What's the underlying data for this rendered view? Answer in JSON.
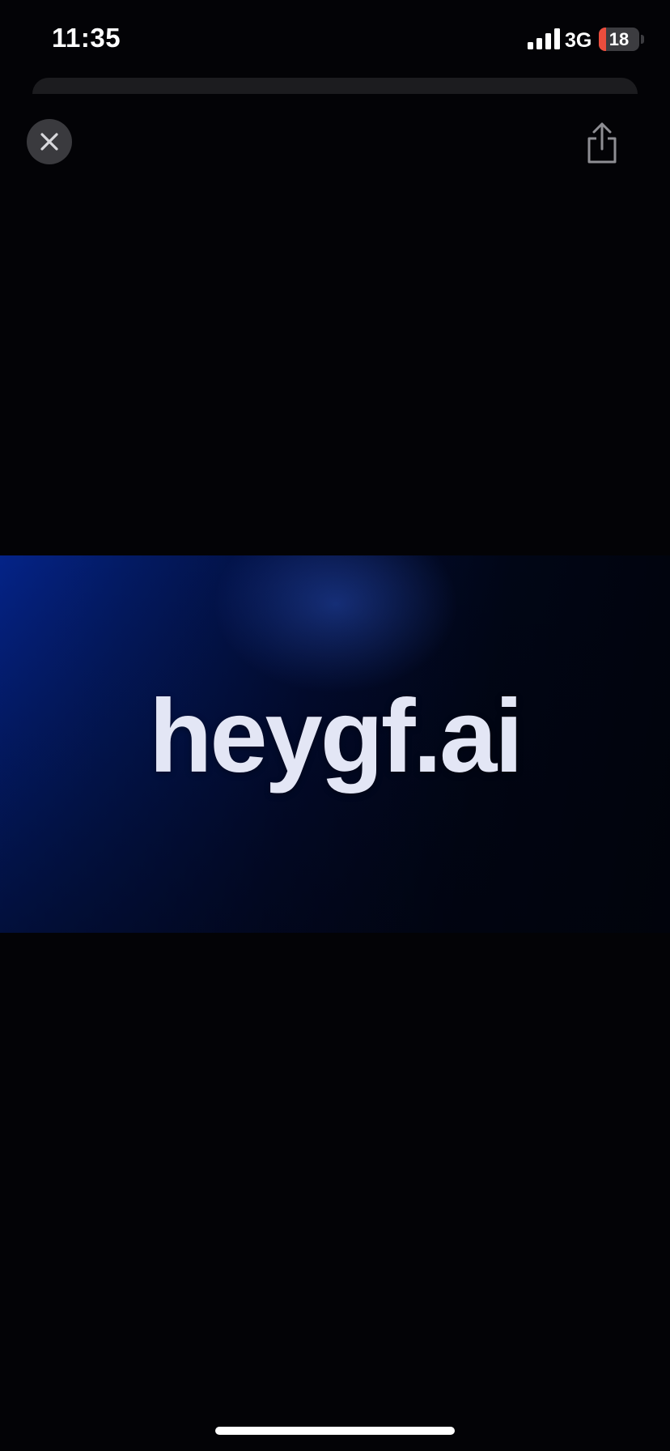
{
  "status_bar": {
    "time": "11:35",
    "network": "3G",
    "battery_level": "18",
    "battery_fraction": 0.18,
    "signal_icon": "cellular-signal-icon"
  },
  "viewer": {
    "close_icon": "close-icon",
    "share_icon": "share-icon"
  },
  "media": {
    "title": "heygf.ai"
  },
  "colors": {
    "background": "#030306",
    "accent_blue": "#042388",
    "battery_low": "#eb4d3d",
    "title_text": "#e3e6f5"
  }
}
